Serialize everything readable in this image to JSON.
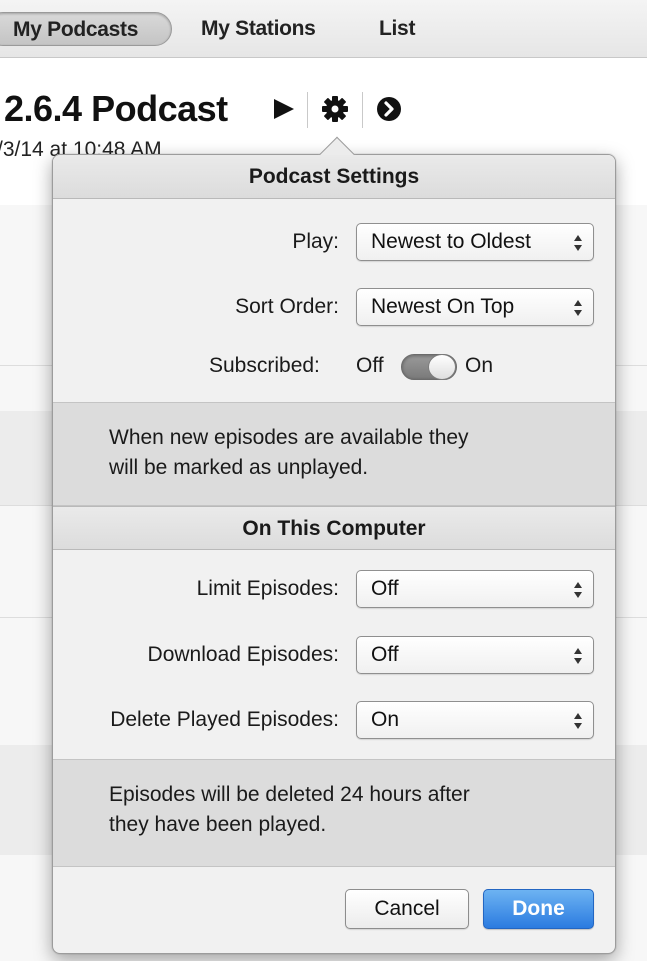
{
  "tabs": [
    {
      "label": "My Podcasts",
      "selected": true
    },
    {
      "label": "My Stations",
      "selected": false
    },
    {
      "label": "List",
      "selected": false
    }
  ],
  "header": {
    "title": "2.6.4 Podcast",
    "date_fragment": "/3/14 at 10:48 AM"
  },
  "settings": {
    "title": "Podcast Settings",
    "play_label": "Play:",
    "play_value": "Newest to Oldest",
    "sort_label": "Sort Order:",
    "sort_value": "Newest On Top",
    "subscribed_label": "Subscribed:",
    "subscribed_off": "Off",
    "subscribed_on": "On",
    "subscribed_state": "on",
    "info_line1": "When new episodes are available they",
    "info_line2": "will be marked as unplayed."
  },
  "computer": {
    "title": "On This Computer",
    "limit_label": "Limit Episodes:",
    "limit_value": "Off",
    "download_label": "Download Episodes:",
    "download_value": "Off",
    "delete_label": "Delete Played Episodes:",
    "delete_value": "On",
    "info_line1": "Episodes will be deleted 24 hours after",
    "info_line2": "they have been played."
  },
  "buttons": {
    "cancel": "Cancel",
    "done": "Done"
  },
  "colors": {
    "done_button": "#2b7be0",
    "toggle_track": "#8a8a8a"
  }
}
